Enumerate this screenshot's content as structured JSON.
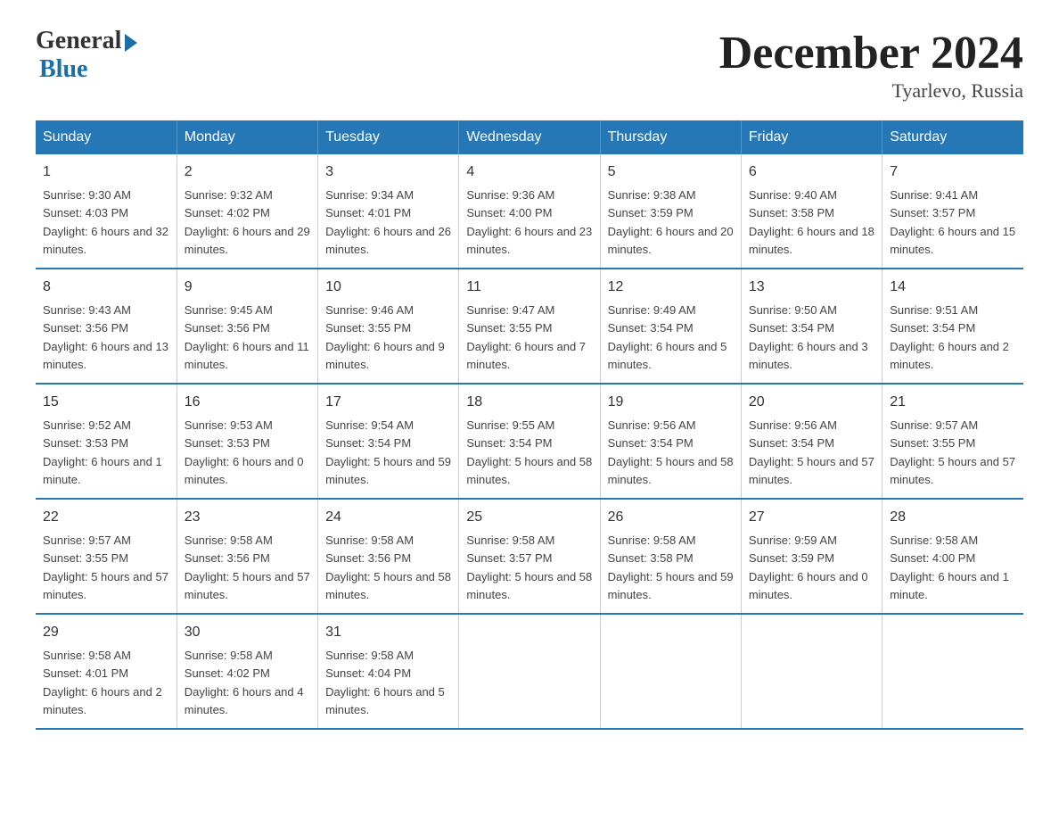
{
  "header": {
    "logo_general": "General",
    "logo_blue": "Blue",
    "month_title": "December 2024",
    "location": "Tyarlevo, Russia"
  },
  "days_of_week": [
    "Sunday",
    "Monday",
    "Tuesday",
    "Wednesday",
    "Thursday",
    "Friday",
    "Saturday"
  ],
  "weeks": [
    [
      {
        "day": "1",
        "sunrise": "9:30 AM",
        "sunset": "4:03 PM",
        "daylight": "6 hours and 32 minutes."
      },
      {
        "day": "2",
        "sunrise": "9:32 AM",
        "sunset": "4:02 PM",
        "daylight": "6 hours and 29 minutes."
      },
      {
        "day": "3",
        "sunrise": "9:34 AM",
        "sunset": "4:01 PM",
        "daylight": "6 hours and 26 minutes."
      },
      {
        "day": "4",
        "sunrise": "9:36 AM",
        "sunset": "4:00 PM",
        "daylight": "6 hours and 23 minutes."
      },
      {
        "day": "5",
        "sunrise": "9:38 AM",
        "sunset": "3:59 PM",
        "daylight": "6 hours and 20 minutes."
      },
      {
        "day": "6",
        "sunrise": "9:40 AM",
        "sunset": "3:58 PM",
        "daylight": "6 hours and 18 minutes."
      },
      {
        "day": "7",
        "sunrise": "9:41 AM",
        "sunset": "3:57 PM",
        "daylight": "6 hours and 15 minutes."
      }
    ],
    [
      {
        "day": "8",
        "sunrise": "9:43 AM",
        "sunset": "3:56 PM",
        "daylight": "6 hours and 13 minutes."
      },
      {
        "day": "9",
        "sunrise": "9:45 AM",
        "sunset": "3:56 PM",
        "daylight": "6 hours and 11 minutes."
      },
      {
        "day": "10",
        "sunrise": "9:46 AM",
        "sunset": "3:55 PM",
        "daylight": "6 hours and 9 minutes."
      },
      {
        "day": "11",
        "sunrise": "9:47 AM",
        "sunset": "3:55 PM",
        "daylight": "6 hours and 7 minutes."
      },
      {
        "day": "12",
        "sunrise": "9:49 AM",
        "sunset": "3:54 PM",
        "daylight": "6 hours and 5 minutes."
      },
      {
        "day": "13",
        "sunrise": "9:50 AM",
        "sunset": "3:54 PM",
        "daylight": "6 hours and 3 minutes."
      },
      {
        "day": "14",
        "sunrise": "9:51 AM",
        "sunset": "3:54 PM",
        "daylight": "6 hours and 2 minutes."
      }
    ],
    [
      {
        "day": "15",
        "sunrise": "9:52 AM",
        "sunset": "3:53 PM",
        "daylight": "6 hours and 1 minute."
      },
      {
        "day": "16",
        "sunrise": "9:53 AM",
        "sunset": "3:53 PM",
        "daylight": "6 hours and 0 minutes."
      },
      {
        "day": "17",
        "sunrise": "9:54 AM",
        "sunset": "3:54 PM",
        "daylight": "5 hours and 59 minutes."
      },
      {
        "day": "18",
        "sunrise": "9:55 AM",
        "sunset": "3:54 PM",
        "daylight": "5 hours and 58 minutes."
      },
      {
        "day": "19",
        "sunrise": "9:56 AM",
        "sunset": "3:54 PM",
        "daylight": "5 hours and 58 minutes."
      },
      {
        "day": "20",
        "sunrise": "9:56 AM",
        "sunset": "3:54 PM",
        "daylight": "5 hours and 57 minutes."
      },
      {
        "day": "21",
        "sunrise": "9:57 AM",
        "sunset": "3:55 PM",
        "daylight": "5 hours and 57 minutes."
      }
    ],
    [
      {
        "day": "22",
        "sunrise": "9:57 AM",
        "sunset": "3:55 PM",
        "daylight": "5 hours and 57 minutes."
      },
      {
        "day": "23",
        "sunrise": "9:58 AM",
        "sunset": "3:56 PM",
        "daylight": "5 hours and 57 minutes."
      },
      {
        "day": "24",
        "sunrise": "9:58 AM",
        "sunset": "3:56 PM",
        "daylight": "5 hours and 58 minutes."
      },
      {
        "day": "25",
        "sunrise": "9:58 AM",
        "sunset": "3:57 PM",
        "daylight": "5 hours and 58 minutes."
      },
      {
        "day": "26",
        "sunrise": "9:58 AM",
        "sunset": "3:58 PM",
        "daylight": "5 hours and 59 minutes."
      },
      {
        "day": "27",
        "sunrise": "9:59 AM",
        "sunset": "3:59 PM",
        "daylight": "6 hours and 0 minutes."
      },
      {
        "day": "28",
        "sunrise": "9:58 AM",
        "sunset": "4:00 PM",
        "daylight": "6 hours and 1 minute."
      }
    ],
    [
      {
        "day": "29",
        "sunrise": "9:58 AM",
        "sunset": "4:01 PM",
        "daylight": "6 hours and 2 minutes."
      },
      {
        "day": "30",
        "sunrise": "9:58 AM",
        "sunset": "4:02 PM",
        "daylight": "6 hours and 4 minutes."
      },
      {
        "day": "31",
        "sunrise": "9:58 AM",
        "sunset": "4:04 PM",
        "daylight": "6 hours and 5 minutes."
      },
      null,
      null,
      null,
      null
    ]
  ]
}
